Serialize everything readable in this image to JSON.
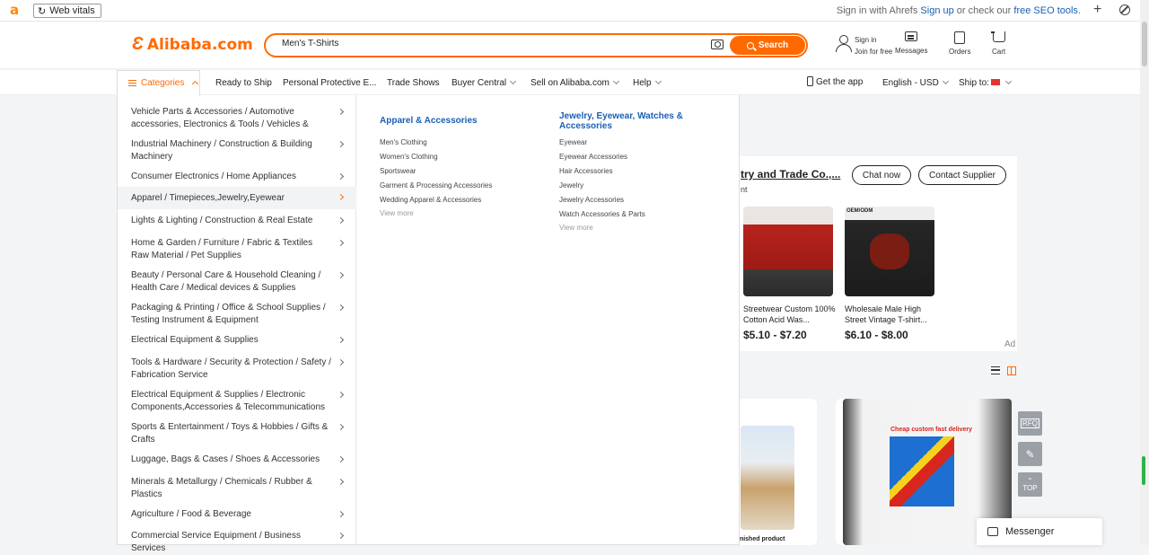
{
  "extension": {
    "logo_letter": "a",
    "web_vitals": "Web vitals",
    "prefix": "Sign in with Ahrefs",
    "sign_up": "Sign up",
    "middle": "or check our",
    "seo_tools": "free SEO tools",
    "suffix": "."
  },
  "header": {
    "logo": "Alibaba.com",
    "search_value": "Men's T-Shirts",
    "search_button": "Search",
    "sign_in": "Sign in",
    "join": "Join for free",
    "messages": "Messages",
    "orders": "Orders",
    "cart": "Cart"
  },
  "nav": {
    "categories": "Categories",
    "items": [
      "Ready to Ship",
      "Personal Protective E...",
      "Trade Shows",
      "Buyer Central",
      "Sell on Alibaba.com",
      "Help"
    ],
    "get_app": "Get the app",
    "language": "English - USD",
    "ship_to": "Ship to:"
  },
  "categories": [
    "Vehicle Parts & Accessories / Automotive accessories, Electronics & Tools / Vehicles &",
    "Industrial Machinery / Construction & Building Machinery",
    "Consumer Electronics / Home Appliances",
    "Apparel / Timepieces,Jewelry,Eyewear",
    "Lights & Lighting / Construction & Real Estate",
    "Home & Garden / Furniture / Fabric & Textiles Raw Material / Pet Supplies",
    "Beauty / Personal Care & Household Cleaning / Health Care / Medical devices & Supplies",
    "Packaging & Printing / Office & School Supplies / Testing Instrument & Equipment",
    "Electrical Equipment & Supplies",
    "Tools & Hardware / Security & Protection / Safety / Fabrication Service",
    "Electrical Equipment & Supplies / Electronic Components,Accessories & Telecommunications",
    "Sports & Entertainment / Toys & Hobbies / Gifts & Crafts",
    "Luggage, Bags & Cases / Shoes & Accessories",
    "Minerals & Metallurgy / Chemicals / Rubber & Plastics",
    "Agriculture / Food & Beverage",
    "Commercial Service Equipment / Business Services"
  ],
  "subcategories": {
    "col1": {
      "title": "Apparel & Accessories",
      "links": [
        "Men's Clothing",
        "Women's Clothing",
        "Sportswear",
        "Garment & Processing Accessories",
        "Wedding Apparel & Accessories"
      ],
      "more": "View more"
    },
    "col2": {
      "title": "Jewelry, Eyewear, Watches & Accessories",
      "links": [
        "Eyewear",
        "Eyewear Accessories",
        "Hair Accessories",
        "Jewelry",
        "Jewelry Accessories",
        "Watch Accessories & Parts"
      ],
      "more": "View more"
    }
  },
  "background": {
    "supplier": "try and Trade Co.,...",
    "supplier_sub": "nt",
    "chat_now": "Chat now",
    "contact_supplier": "Contact Supplier",
    "product1_name": "Streetwear Custom 100% Cotton Acid Was...",
    "product1_price": "$5.10 - $7.20",
    "product2_badge": "OEM/ODM",
    "product2_name": "Wholesale Male High Street Vintage T-shirt...",
    "product2_price": "$6.10 - $8.00",
    "ad": "Ad",
    "card1_caption": "inished product",
    "card2_banner": "Cheap custom fast delivery",
    "rfq": "RFQ",
    "top": "TOP",
    "messenger": "Messenger"
  },
  "colors": {
    "brand": "#ff6a00",
    "link": "#1a5fb4"
  }
}
